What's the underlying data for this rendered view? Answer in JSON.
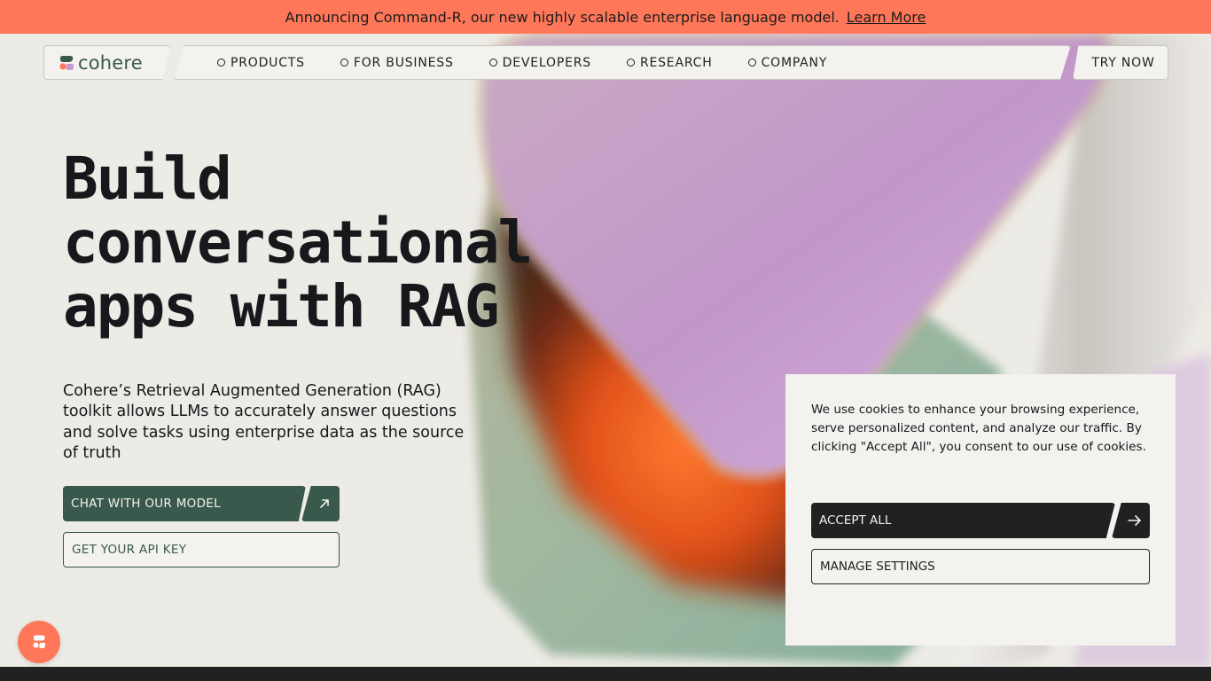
{
  "announcement": {
    "text": "Announcing Command-R, our new highly scalable enterprise language model.",
    "link": "Learn More"
  },
  "nav": {
    "logo": "cohere",
    "items": [
      {
        "label": "PRODUCTS"
      },
      {
        "label": "FOR BUSINESS"
      },
      {
        "label": "DEVELOPERS"
      },
      {
        "label": "RESEARCH"
      },
      {
        "label": "COMPANY"
      }
    ],
    "cta": "TRY NOW"
  },
  "hero": {
    "title_lines": [
      "Build",
      "conversational",
      "apps with RAG"
    ],
    "subtitle": "Cohere’s Retrieval Augmented Generation (RAG) toolkit allows LLMs to accurately answer questions and solve tasks using enterprise data as the source of truth",
    "primary_button": "CHAT WITH OUR MODEL",
    "secondary_button": "GET YOUR API KEY"
  },
  "cookie": {
    "text": "We use cookies to enhance your browsing experience, serve personalized content, and analyze our traffic. By clicking \"Accept All\", you consent to our use of cookies.",
    "accept": "ACCEPT ALL",
    "manage": "MANAGE SETTINGS"
  },
  "colors": {
    "announcement_bg": "#ff7759",
    "brand_green": "#39594d",
    "page_bg": "#edebe5",
    "dark": "#212121",
    "lavender": "#c89bd0"
  },
  "icons": {
    "chat_arrow": "arrow-up-right-icon",
    "accept_arrow": "arrow-right-icon",
    "logo": "cohere-logo-icon",
    "chat_bubble": "cohere-chat-icon"
  }
}
